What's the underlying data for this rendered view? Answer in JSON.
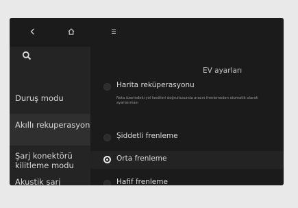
{
  "topbar": {
    "back_icon": "chevron-left-icon",
    "home_icon": "home-icon",
    "menu_icon": "menu-icon"
  },
  "sidebar": {
    "search_icon": "search-icon",
    "items": [
      {
        "label": "Duruş modu"
      },
      {
        "label": "Akıllı rekuperasyon"
      },
      {
        "label": "Şarj konektörü kilitleme modu"
      },
      {
        "label": "Akustik şarj bilgileri"
      }
    ]
  },
  "main": {
    "title": "EV ayarları",
    "options": [
      {
        "label": "Harita reküperasyonu",
        "description": "Nota üzerindeki yol kesitleri doğrultusunda aracın frenlemeden otomatik olarak ayarlanması",
        "selected": false
      },
      {
        "label": "Şiddetli frenleme",
        "selected": false
      },
      {
        "label": "Orta frenleme",
        "selected": true
      },
      {
        "label": "Hafif frenleme",
        "selected": false
      }
    ]
  },
  "colors": {
    "background": "#e9e9e9",
    "screen": "#1b1b1b",
    "sidebar": "#242424",
    "text": "#dcdcdc"
  }
}
